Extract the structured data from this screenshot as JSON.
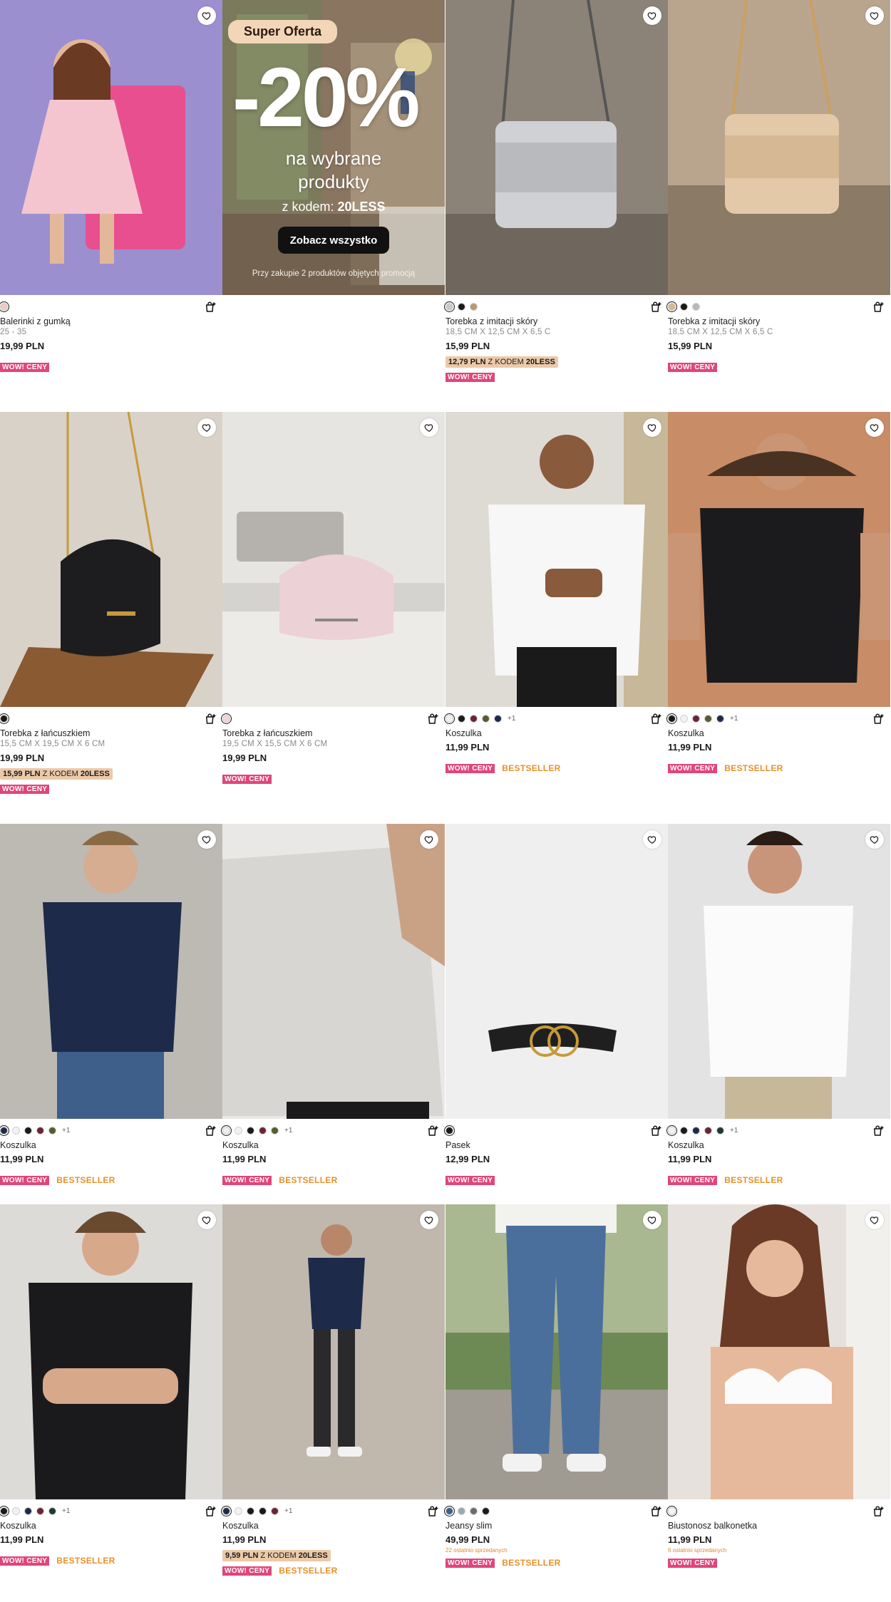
{
  "banner": {
    "badge": "Super Oferta",
    "discount": "-20%",
    "line1": "na wybrane",
    "line2": "produkty",
    "code_prefix": "z kodem: ",
    "code": "20LESS",
    "cta": "Zobacz wszystko",
    "fine_print": "Przy zakupie 2 produktów objętych promocją"
  },
  "products": [
    {
      "name": "Balerinki z gumką",
      "size": "25 - 35",
      "price": "19,99 PLN",
      "swatches": [
        "#f1c9c0"
      ],
      "more": "",
      "promo_price": "",
      "promo_suffix": "",
      "promo_code": "",
      "last_sold": "",
      "wow": "WOW! CENY",
      "bestseller": "",
      "image": "girl-pink-dress"
    },
    {
      "name": "Torebka z imitacji skóry",
      "size": "18,5 CM X 12,5 CM X 6,5 C",
      "price": "15,99 PLN",
      "swatches": [
        "#c7c9cf",
        "#1a1a1a",
        "#b99874"
      ],
      "more": "",
      "promo_price": "12,79 PLN",
      "promo_suffix": " Z KODEM ",
      "promo_code": "20LESS",
      "last_sold": "",
      "wow": "WOW! CENY",
      "bestseller": "",
      "image": "grey-handbag"
    },
    {
      "name": "Torebka z imitacji skóry",
      "size": "18,5 CM X 12,5 CM X 6,5 C",
      "price": "15,99 PLN",
      "swatches": [
        "#d8b690",
        "#1a1a1a",
        "#b8b8b8"
      ],
      "more": "",
      "promo_price": "",
      "promo_suffix": "",
      "promo_code": "",
      "last_sold": "",
      "wow": "WOW! CENY",
      "bestseller": "",
      "image": "beige-handbag"
    },
    {
      "name": "Torebka z łańcuszkiem",
      "size": "15,5 CM X 19,5 CM X 6 CM",
      "price": "19,99 PLN",
      "swatches": [
        "#1a1a1a"
      ],
      "more": "",
      "promo_price": "15,99 PLN",
      "promo_suffix": " Z KODEM ",
      "promo_code": "20LESS",
      "last_sold": "",
      "wow": "WOW! CENY",
      "bestseller": "",
      "image": "black-chain-bag"
    },
    {
      "name": "Torebka z łańcuszkiem",
      "size": "19,5 CM X 15,5 CM X 6 CM",
      "price": "19,99 PLN",
      "swatches": [
        "#f2d5d8"
      ],
      "more": "",
      "promo_price": "",
      "promo_suffix": "",
      "promo_code": "",
      "last_sold": "",
      "wow": "WOW! CENY",
      "bestseller": "",
      "image": "pink-chain-bag"
    },
    {
      "name": "Koszulka",
      "size": "",
      "price": "11,99 PLN",
      "swatches": [
        "#f2f2f2",
        "#1a1a1a",
        "#6b2434",
        "#5a5a32",
        "#1e2a4a"
      ],
      "more": "+1",
      "promo_price": "",
      "promo_suffix": "",
      "promo_code": "",
      "last_sold": "",
      "wow": "WOW! CENY",
      "bestseller": "BESTSELLER",
      "image": "white-tee-man"
    },
    {
      "name": "Koszulka",
      "size": "",
      "price": "11,99 PLN",
      "swatches": [
        "#1a1a1a",
        "#f2f2f2",
        "#6b2434",
        "#5a5a32",
        "#1e2a4a"
      ],
      "more": "+1",
      "promo_price": "",
      "promo_suffix": "",
      "promo_code": "",
      "last_sold": "",
      "wow": "WOW! CENY",
      "bestseller": "BESTSELLER",
      "image": "black-tee-man"
    },
    {
      "name": "Koszulka",
      "size": "",
      "price": "11,99 PLN",
      "swatches": [
        "#1e2a4a",
        "#f2f2f2",
        "#1a1a1a",
        "#6b2434",
        "#5a5a32"
      ],
      "more": "+1",
      "promo_price": "",
      "promo_suffix": "",
      "promo_code": "",
      "last_sold": "",
      "wow": "WOW! CENY",
      "bestseller": "BESTSELLER",
      "image": "navy-tee-man"
    },
    {
      "name": "Koszulka",
      "size": "",
      "price": "11,99 PLN",
      "swatches": [
        "#eeeeee",
        "#f2f2f2",
        "#1a1a1a",
        "#6b2434",
        "#5a5a32"
      ],
      "more": "+1",
      "promo_price": "",
      "promo_suffix": "",
      "promo_code": "",
      "last_sold": "",
      "wow": "WOW! CENY",
      "bestseller": "BESTSELLER",
      "image": "grey-tee-closeup"
    },
    {
      "name": "Pasek",
      "size": "",
      "price": "12,99 PLN",
      "swatches": [
        "#1a1a1a"
      ],
      "more": "",
      "promo_price": "",
      "promo_suffix": "",
      "promo_code": "",
      "last_sold": "",
      "wow": "WOW! CENY",
      "bestseller": "",
      "image": "black-belt"
    },
    {
      "name": "Koszulka",
      "size": "",
      "price": "11,99 PLN",
      "swatches": [
        "#f2f2f2",
        "#1a1a1a",
        "#1e2a4a",
        "#6b2434",
        "#1f3a36"
      ],
      "more": "+1",
      "promo_price": "",
      "promo_suffix": "",
      "promo_code": "",
      "last_sold": "",
      "wow": "WOW! CENY",
      "bestseller": "BESTSELLER",
      "image": "white-vneck-man"
    },
    {
      "name": "Koszulka",
      "size": "",
      "price": "11,99 PLN",
      "swatches": [
        "#1a1a1a",
        "#f2f2f2",
        "#1e2a4a",
        "#6b2434",
        "#1f3a36"
      ],
      "more": "+1",
      "promo_price": "",
      "promo_suffix": "",
      "promo_code": "",
      "last_sold": "",
      "wow": "WOW! CENY",
      "bestseller": "BESTSELLER",
      "image": "black-vneck-man"
    },
    {
      "name": "Koszulka",
      "size": "",
      "price": "11,99 PLN",
      "swatches": [
        "#1e2a4a",
        "#f2f2f2",
        "#1a1a1a",
        "#1a1a1a",
        "#6b2434"
      ],
      "more": "+1",
      "promo_price": "9,59 PLN",
      "promo_suffix": " Z KODEM ",
      "promo_code": "20LESS",
      "last_sold": "",
      "wow": "WOW! CENY",
      "bestseller": "BESTSELLER",
      "image": "navy-tee-fullbody"
    },
    {
      "name": "Jeansy slim",
      "size": "",
      "price": "49,99 PLN",
      "swatches": [
        "#3d5f8a",
        "#9aa8b0",
        "#6b6b6b",
        "#1a1a1a"
      ],
      "more": "",
      "promo_price": "",
      "promo_suffix": "",
      "promo_code": "",
      "last_sold": "22 ostatnio sprzedanych",
      "wow": "WOW! CENY",
      "bestseller": "BESTSELLER",
      "image": "slim-jeans"
    },
    {
      "name": "Biustonosz balkonetka",
      "size": "",
      "price": "11,99 PLN",
      "swatches": [
        "#f5f5f5"
      ],
      "more": "",
      "promo_price": "",
      "promo_suffix": "",
      "promo_code": "",
      "last_sold": "6 ostatnio sprzedanych",
      "wow": "WOW! CENY",
      "bestseller": "",
      "image": "white-balconette-bra"
    }
  ]
}
